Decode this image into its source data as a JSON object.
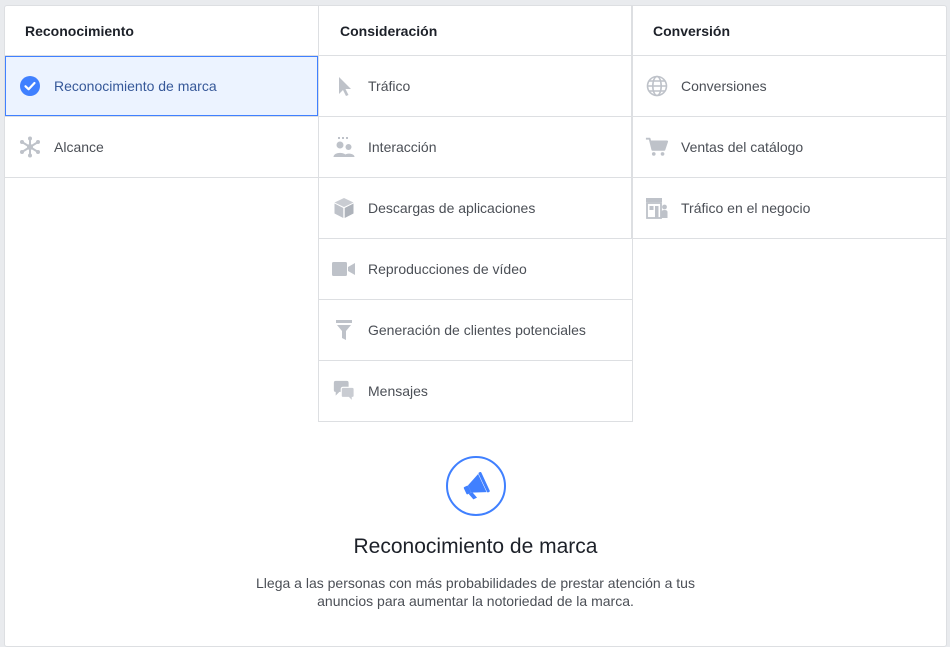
{
  "columns": [
    {
      "title": "Reconocimiento",
      "items": [
        {
          "label": "Reconocimiento de marca",
          "icon": "check-circle-icon",
          "selected": true
        },
        {
          "label": "Alcance",
          "icon": "reach-icon",
          "selected": false
        }
      ]
    },
    {
      "title": "Consideración",
      "items": [
        {
          "label": "Tráfico",
          "icon": "cursor-icon"
        },
        {
          "label": "Interacción",
          "icon": "people-icon"
        },
        {
          "label": "Descargas de aplicaciones",
          "icon": "box-icon"
        },
        {
          "label": "Reproducciones de vídeo",
          "icon": "video-camera-icon"
        },
        {
          "label": "Generación de clientes potenciales",
          "icon": "funnel-icon"
        },
        {
          "label": "Mensajes",
          "icon": "chat-bubbles-icon"
        }
      ]
    },
    {
      "title": "Conversión",
      "items": [
        {
          "label": "Conversiones",
          "icon": "globe-icon"
        },
        {
          "label": "Ventas del catálogo",
          "icon": "shopping-cart-icon"
        },
        {
          "label": "Tráfico en el negocio",
          "icon": "store-icon"
        }
      ]
    }
  ],
  "detail": {
    "icon": "megaphone-icon",
    "title": "Reconocimiento de marca",
    "description": "Llega a las personas con más probabilidades de prestar atención a tus anuncios para aumentar la notoriedad de la marca."
  },
  "colors": {
    "accent": "#4080ff",
    "selected_bg": "#ecf3ff",
    "selected_text": "#365899",
    "icon_gray": "#bec2c9",
    "border": "#dddfe2"
  }
}
